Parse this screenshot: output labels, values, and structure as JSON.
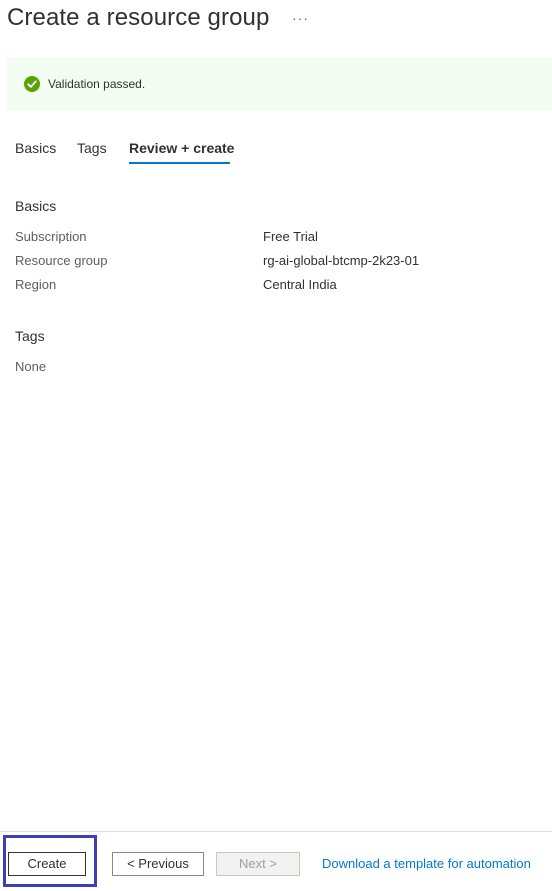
{
  "header": {
    "title": "Create a resource group",
    "more_label": "···"
  },
  "banner": {
    "icon": "checkmark-circle-icon",
    "text": "Validation passed.",
    "icon_color": "#57a300",
    "background": "#f3fcf0"
  },
  "tabs": [
    {
      "label": "Basics",
      "active": false
    },
    {
      "label": "Tags",
      "active": false
    },
    {
      "label": "Review + create",
      "active": true
    }
  ],
  "sections": {
    "basics": {
      "title": "Basics",
      "rows": [
        {
          "label": "Subscription",
          "value": "Free Trial"
        },
        {
          "label": "Resource group",
          "value": "rg-ai-global-btcmp-2k23-01"
        },
        {
          "label": "Region",
          "value": "Central India"
        }
      ]
    },
    "tags": {
      "title": "Tags",
      "value": "None"
    }
  },
  "footer": {
    "create_label": "Create",
    "previous_label": "< Previous",
    "next_label": "Next >",
    "download_link": "Download a template for automation"
  },
  "colors": {
    "accent": "#0078d4",
    "focus_box": "#3b3fb8"
  }
}
